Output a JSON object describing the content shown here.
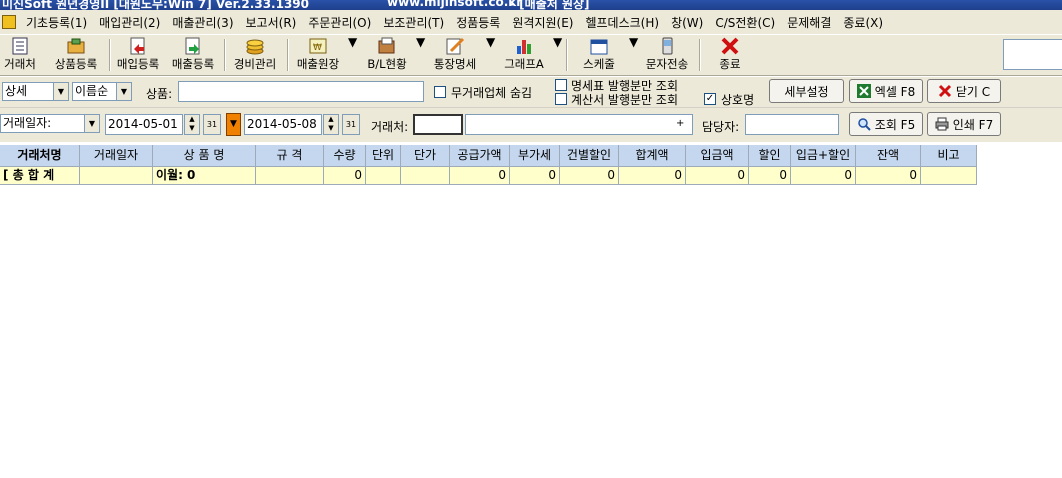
{
  "window": {
    "title": "미진Soft 원년경영II [대원노무:Win 7] Ver.2.33.1390",
    "url": "www.mijinsoft.co.kr",
    "doc_title": " - [매출처 원장]"
  },
  "menu": [
    "기초등록(1)",
    "매입관리(2)",
    "매출관리(3)",
    "보고서(R)",
    "주문관리(O)",
    "보조관리(T)",
    "정품등록",
    "원격지원(E)",
    "헬프데스크(H)",
    "창(W)",
    "C/S전환(C)",
    "문제해결",
    "종료(X)"
  ],
  "toolbar": {
    "customer": "거래처",
    "product_reg": "상품등록",
    "purchase_reg": "매입등록",
    "sales_reg": "매출등록",
    "expense": "경비관리",
    "sales_ledger": "매출원장",
    "bl_status": "B/L현황",
    "bank_statement": "통장명세",
    "graph": "그래프A",
    "schedule": "스케줄",
    "sms": "문자전송",
    "exit": "종료"
  },
  "filters": {
    "mode": "상세",
    "sort": "이름순",
    "product_label": "상품:",
    "product_value": "",
    "hide_no_trade": "무거래업체 숨김",
    "statement_only": "명세표 발행분만 조회",
    "invoice_only": "계산서 발행분만 조회",
    "company_name": "상호명",
    "detail_settings": "세부설정",
    "excel": "엑셀 F8",
    "close": "닫기 C",
    "date_type": "거래일자:",
    "date_from": "2014-05-01",
    "date_to": "2014-05-08",
    "cal_day": "31",
    "customer_label": "거래처:",
    "customer_code": "",
    "customer_name": "",
    "manager_label": "담당자:",
    "manager_value": "",
    "search": "조회 F5",
    "print": "인쇄 F7",
    "plus": "+"
  },
  "grid": {
    "headers": [
      "거래처명",
      "거래일자",
      "상 품 명",
      "규 격",
      "수량",
      "단위",
      "단가",
      "공급가액",
      "부가세",
      "건별할인",
      "합계액",
      "입금액",
      "할인",
      "입금+할인",
      "잔액",
      "비고"
    ],
    "summary": [
      "[ 총 합 계",
      "",
      "이월: 0",
      "",
      "0",
      "",
      "",
      "0",
      "0",
      "0",
      "0",
      "0",
      "0",
      "0",
      "0",
      ""
    ]
  },
  "colors": {
    "title_bg": "#2a52a8",
    "face": "#ece9d8",
    "header_bg": "#c5d7ee",
    "summary_bg": "#ffffcc",
    "accent_orange": "#f08000"
  }
}
